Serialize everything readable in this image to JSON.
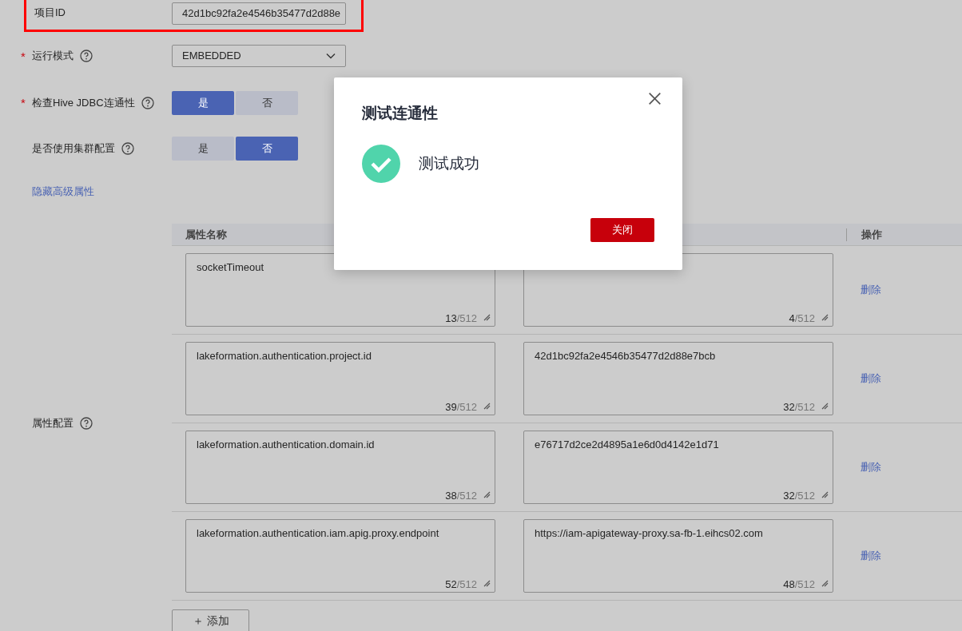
{
  "project_id": {
    "label": "项目ID",
    "value": "42d1bc92fa2e4546b35477d2d88e",
    "highlighted": true
  },
  "run_mode": {
    "label": "运行模式",
    "required_mark": "*",
    "value": "EMBEDDED"
  },
  "toggles": [
    {
      "label": "检查Hive JDBC连通性",
      "required_mark": "*",
      "options": [
        {
          "label": "是",
          "selected": true
        },
        {
          "label": "否",
          "selected": false
        }
      ]
    },
    {
      "label": "是否使用集群配置",
      "options": [
        {
          "label": "是",
          "selected": false
        },
        {
          "label": "否",
          "selected": true
        }
      ]
    }
  ],
  "advanced_link": "隐藏高级属性",
  "properties": {
    "label": "属性配置",
    "columns": {
      "name": "属性名称",
      "action": "操作"
    },
    "rows": [
      {
        "name": "socketTimeout",
        "name_count": "13",
        "name_limit": "/512",
        "value_count": "4",
        "value_limit": "/512",
        "action": "删除"
      },
      {
        "name": "lakeformation.authentication.project.id",
        "name_count": "39",
        "name_limit": "/512",
        "value": "42d1bc92fa2e4546b35477d2d88e7bcb",
        "value_count": "32",
        "value_limit": "/512",
        "action": "删除"
      },
      {
        "name": "lakeformation.authentication.domain.id",
        "name_count": "38",
        "name_limit": "/512",
        "value": "e76717d2ce2d4895a1e6d0d4142e1d71",
        "value_count": "32",
        "value_limit": "/512",
        "action": "删除"
      },
      {
        "name": "lakeformation.authentication.iam.apig.proxy.endpoint",
        "name_count": "52",
        "name_limit": "/512",
        "value": "https://iam-apigateway-proxy.sa-fb-1.eihcs02.com",
        "value_count": "48",
        "value_limit": "/512",
        "action": "删除"
      }
    ],
    "add_button": {
      "icon": "＋",
      "label": "添加"
    }
  },
  "dialog": {
    "title": "测试连通性",
    "kind": "success",
    "message": "测试成功",
    "close_button": "关闭"
  }
}
